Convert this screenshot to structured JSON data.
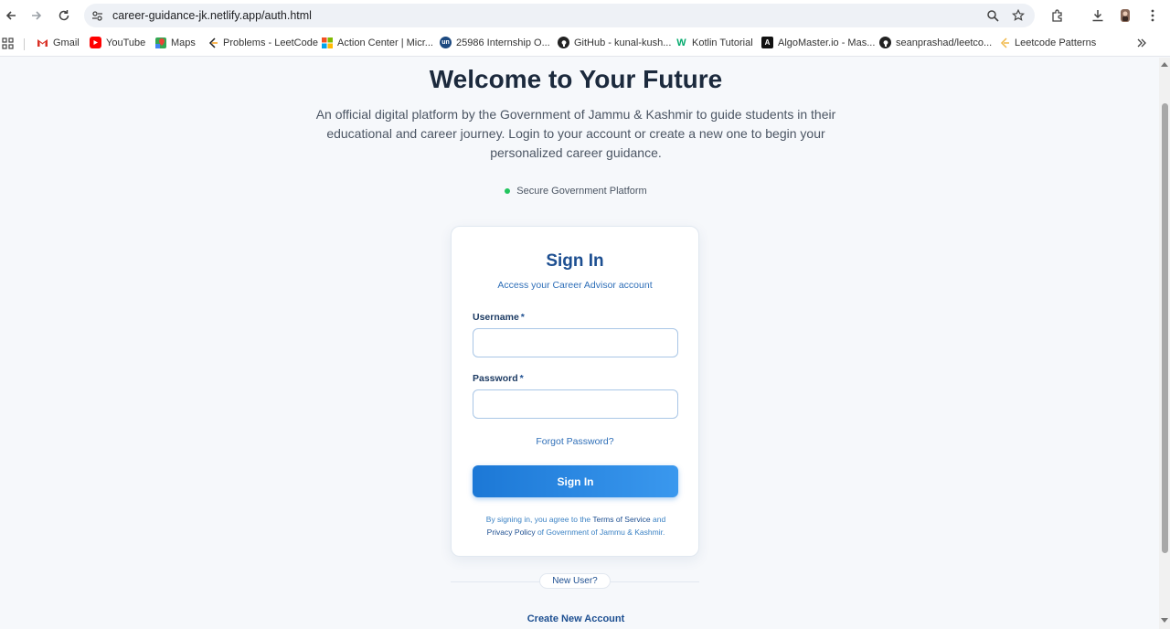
{
  "browser": {
    "url": "career-guidance-jk.netlify.app/auth.html",
    "bookmarks": [
      {
        "label": "Gmail",
        "icon": "gmail-icon"
      },
      {
        "label": "YouTube",
        "icon": "youtube-icon"
      },
      {
        "label": "Maps",
        "icon": "maps-icon"
      },
      {
        "label": "Problems - LeetCode",
        "icon": "leetcode-icon"
      },
      {
        "label": "Action Center | Micr...",
        "icon": "microsoft-icon"
      },
      {
        "label": "25986 Internship O...",
        "icon": "unstop-icon"
      },
      {
        "label": "GitHub - kunal-kush...",
        "icon": "github-icon"
      },
      {
        "label": "Kotlin Tutorial",
        "icon": "w3-icon"
      },
      {
        "label": "AlgoMaster.io - Mas...",
        "icon": "algomaster-icon"
      },
      {
        "label": "seanprashad/leetco...",
        "icon": "github-icon"
      },
      {
        "label": "Leetcode Patterns",
        "icon": "leetcode-icon"
      }
    ]
  },
  "hero": {
    "title": "Welcome to Your Future",
    "description": "An official digital platform by the Government of Jammu & Kashmir to guide students in their educational and career journey. Login to your account or create a new one to begin your personalized career guidance.",
    "badge": "Secure Government Platform"
  },
  "signin": {
    "title": "Sign In",
    "subtitle": "Access your Career Advisor account",
    "username_label": "Username",
    "password_label": "Password",
    "required_mark": "*",
    "username_value": "",
    "password_value": "",
    "forgot_link": "Forgot Password?",
    "button": "Sign In",
    "terms_prefix": "By signing in, you agree to the",
    "terms_link": "Terms of Service",
    "terms_and": "and",
    "privacy_link": "Privacy Policy",
    "terms_suffix": "of Government of Jammu & Kashmir."
  },
  "footer": {
    "new_user": "New User?",
    "create_account": "Create New Account"
  },
  "colors": {
    "accent": "#1c78d6",
    "heading": "#1c2a3d",
    "brand_blue": "#1d4f91",
    "secure_dot": "#22c55e"
  }
}
